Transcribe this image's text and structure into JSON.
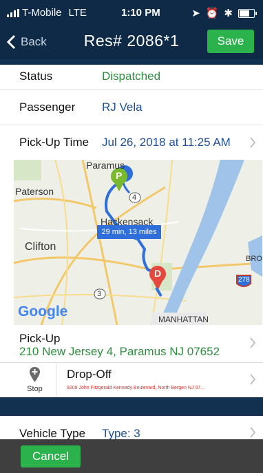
{
  "status_bar": {
    "carrier": "T-Mobile",
    "network": "LTE",
    "time": "1:10 PM",
    "battery_level": 0.8
  },
  "nav": {
    "back_label": "Back",
    "title": "Res# 2086*1",
    "save_label": "Save"
  },
  "details": {
    "status": {
      "label": "Status",
      "value": "Dispatched"
    },
    "passenger": {
      "label": "Passenger",
      "value": "RJ Vela"
    },
    "pickup_time": {
      "label": "Pick-Up Time",
      "value": "Jul 26, 2018 at 11:25 AM"
    }
  },
  "map": {
    "places": [
      "Paramus",
      "Paterson",
      "Hackensack",
      "Clifton",
      "MANHATTAN",
      "BRON"
    ],
    "route_badge": "29 min, 13 miles",
    "pickup_marker": "P",
    "dropoff_marker": "D",
    "highway_shields": [
      "4",
      "3",
      "278"
    ],
    "logo": "Google",
    "colors": {
      "route": "#2f6fdb",
      "pickup_marker": "#7ab82e",
      "dropoff_marker": "#e5493d",
      "water": "#9fc3e9"
    }
  },
  "pickup": {
    "label": "Pick-Up",
    "address": "210 New Jersey 4, Paramus NJ 07652"
  },
  "dropoff": {
    "stop_label": "Stop",
    "label": "Drop-Off",
    "address": "9209 John Fitzgerald Kennedy Boulevard, North Bergen NJ 07..."
  },
  "vehicle": {
    "label": "Vehicle Type",
    "value": "Type: 3"
  },
  "footer": {
    "cancel_label": "Cancel"
  }
}
